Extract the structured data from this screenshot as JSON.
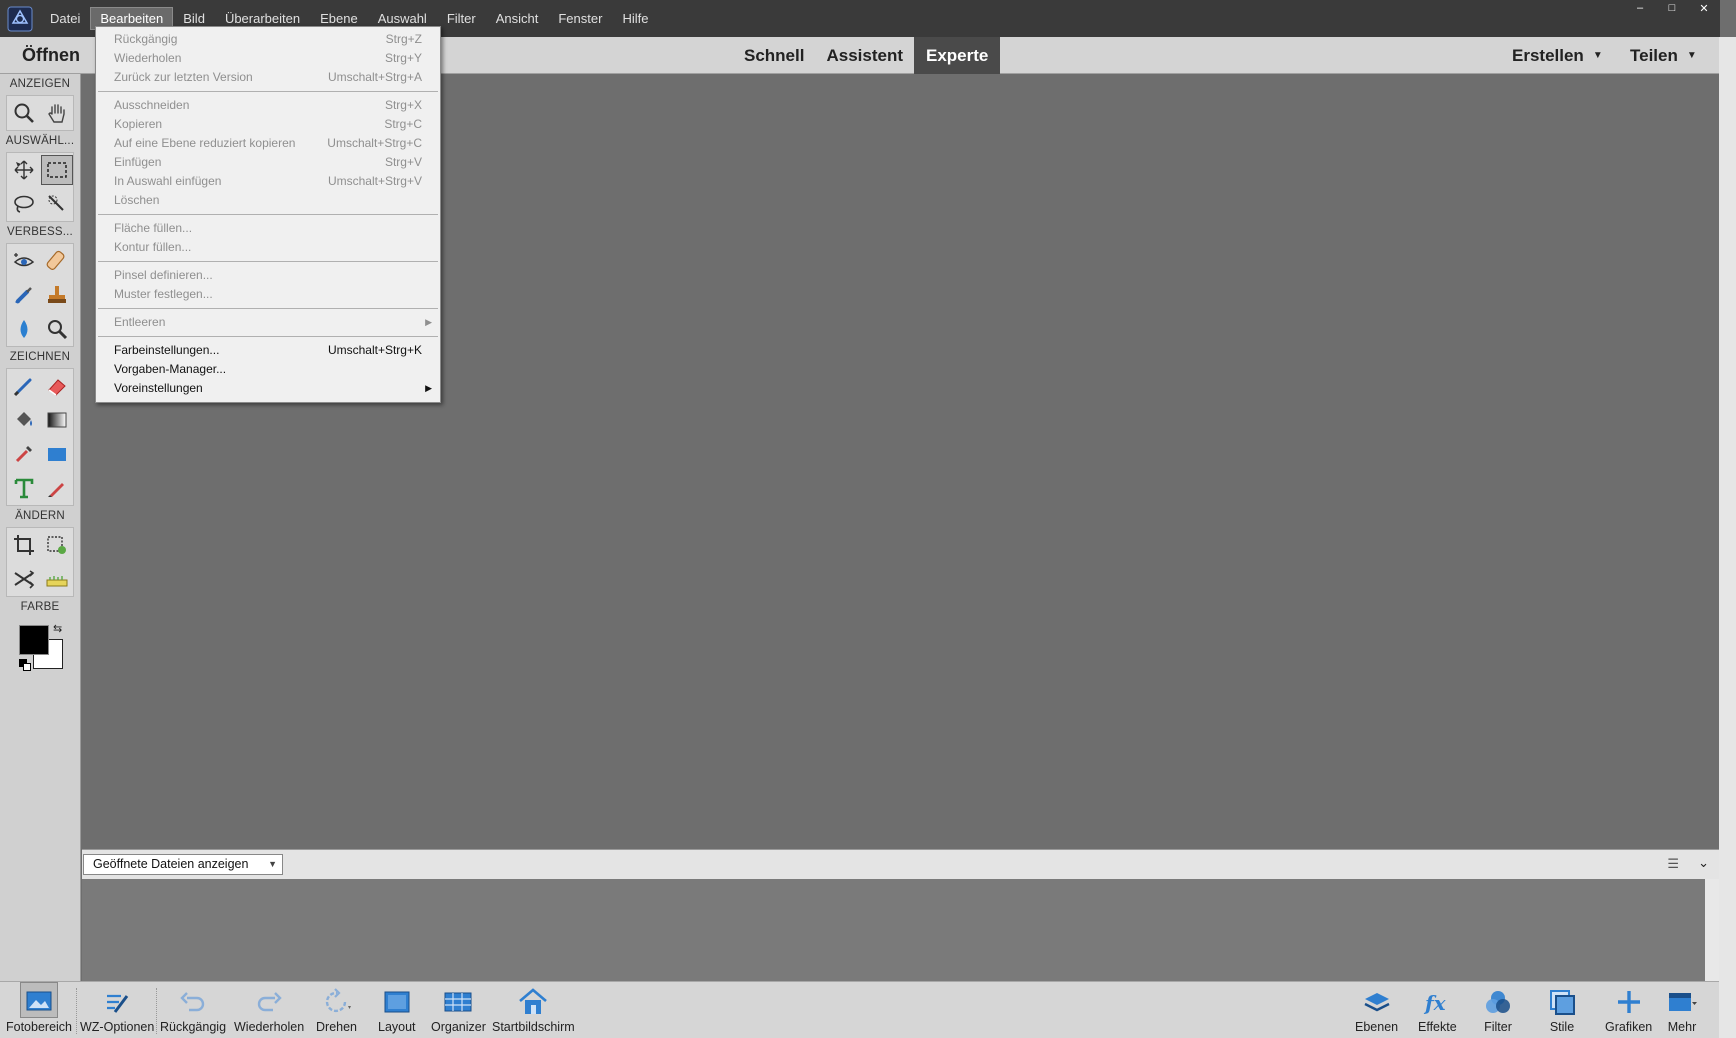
{
  "menubar": {
    "items": [
      "Datei",
      "Bearbeiten",
      "Bild",
      "Überarbeiten",
      "Ebene",
      "Auswahl",
      "Filter",
      "Ansicht",
      "Fenster",
      "Hilfe"
    ],
    "active_item": "Bearbeiten"
  },
  "window_controls": {
    "minimize": "–",
    "maximize": "□",
    "close": "✕"
  },
  "modebar": {
    "open_label": "Öffnen",
    "tabs": [
      "Schnell",
      "Assistent",
      "Experte"
    ],
    "active_tab": "Experte",
    "create_label": "Erstellen",
    "share_label": "Teilen"
  },
  "toolbox": {
    "sections": [
      "ANZEIGEN",
      "AUSWÄHL...",
      "VERBESS...",
      "ZEICHNEN",
      "ÄNDERN",
      "FARBE"
    ],
    "foreground_color": "#000000",
    "background_color": "#ffffff"
  },
  "edit_menu": {
    "groups": [
      [
        {
          "label": "Rückgängig",
          "shortcut": "Strg+Z",
          "enabled": false
        },
        {
          "label": "Wiederholen",
          "shortcut": "Strg+Y",
          "enabled": false
        },
        {
          "label": "Zurück zur letzten Version",
          "shortcut": "Umschalt+Strg+A",
          "enabled": false
        }
      ],
      [
        {
          "label": "Ausschneiden",
          "shortcut": "Strg+X",
          "enabled": false
        },
        {
          "label": "Kopieren",
          "shortcut": "Strg+C",
          "enabled": false
        },
        {
          "label": "Auf eine Ebene reduziert kopieren",
          "shortcut": "Umschalt+Strg+C",
          "enabled": false
        },
        {
          "label": "Einfügen",
          "shortcut": "Strg+V",
          "enabled": false
        },
        {
          "label": "In Auswahl einfügen",
          "shortcut": "Umschalt+Strg+V",
          "enabled": false
        },
        {
          "label": "Löschen",
          "shortcut": "",
          "enabled": false
        }
      ],
      [
        {
          "label": "Fläche füllen...",
          "shortcut": "",
          "enabled": false
        },
        {
          "label": "Kontur füllen...",
          "shortcut": "",
          "enabled": false
        }
      ],
      [
        {
          "label": "Pinsel definieren...",
          "shortcut": "",
          "enabled": false
        },
        {
          "label": "Muster festlegen...",
          "shortcut": "",
          "enabled": false
        }
      ],
      [
        {
          "label": "Entleeren",
          "shortcut": "",
          "enabled": false,
          "submenu": true
        }
      ],
      [
        {
          "label": "Farbeinstellungen...",
          "shortcut": "Umschalt+Strg+K",
          "enabled": true
        },
        {
          "label": "Vorgaben-Manager...",
          "shortcut": "",
          "enabled": true
        },
        {
          "label": "Voreinstellungen",
          "shortcut": "",
          "enabled": true,
          "submenu": true
        }
      ]
    ]
  },
  "photo_bin": {
    "selector_value": "Geöffnete Dateien anzeigen"
  },
  "bottombar": {
    "left_items": [
      "Fotobereich",
      "WZ-Optionen",
      "Rückgängig",
      "Wiederholen",
      "Drehen",
      "Layout",
      "Organizer",
      "Startbildschirm"
    ],
    "right_items": [
      "Ebenen",
      "Effekte",
      "Filter",
      "Stile",
      "Grafiken",
      "Mehr"
    ],
    "active_item": "Fotobereich"
  },
  "colors": {
    "accent_blue": "#2f7fd0",
    "menubar_bg": "#3a3a3a",
    "canvas_bg": "#6e6e6e"
  }
}
